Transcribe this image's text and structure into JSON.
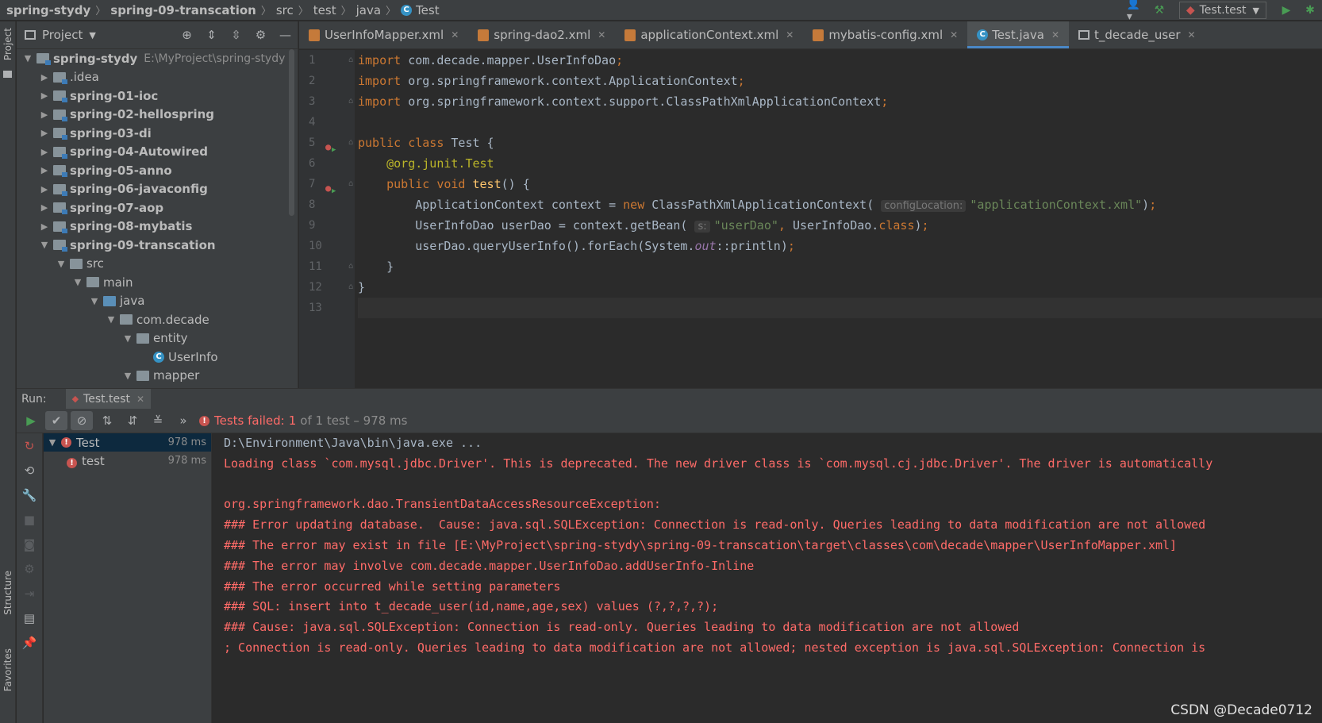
{
  "navbar": {
    "breadcrumbs": [
      "spring-stydy",
      "spring-09-transcation",
      "src",
      "test",
      "java",
      "Test"
    ],
    "run_config": "Test.test"
  },
  "left_strip": {
    "project_label": "Project",
    "structure_label": "Structure",
    "favorites_label": "Favorites"
  },
  "project": {
    "title": "Project",
    "tree": [
      {
        "label": "spring-stydy",
        "extra": "E:\\MyProject\\spring-stydy",
        "arrow": "▼",
        "bold": true,
        "indent": 0
      },
      {
        "label": ".idea",
        "arrow": "▶",
        "bold": false,
        "indent": 1
      },
      {
        "label": "spring-01-ioc",
        "arrow": "▶",
        "bold": true,
        "indent": 1
      },
      {
        "label": "spring-02-hellospring",
        "arrow": "▶",
        "bold": true,
        "indent": 1
      },
      {
        "label": "spring-03-di",
        "arrow": "▶",
        "bold": true,
        "indent": 1
      },
      {
        "label": "spring-04-Autowired",
        "arrow": "▶",
        "bold": true,
        "indent": 1
      },
      {
        "label": "spring-05-anno",
        "arrow": "▶",
        "bold": true,
        "indent": 1
      },
      {
        "label": "spring-06-javaconfig",
        "arrow": "▶",
        "bold": true,
        "indent": 1
      },
      {
        "label": "spring-07-aop",
        "arrow": "▶",
        "bold": true,
        "indent": 1
      },
      {
        "label": "spring-08-mybatis",
        "arrow": "▶",
        "bold": true,
        "indent": 1
      },
      {
        "label": "spring-09-transcation",
        "arrow": "▼",
        "bold": true,
        "indent": 1
      },
      {
        "label": "src",
        "arrow": "▼",
        "bold": false,
        "indent": 2
      },
      {
        "label": "main",
        "arrow": "▼",
        "bold": false,
        "indent": 3
      },
      {
        "label": "java",
        "arrow": "▼",
        "bold": false,
        "indent": 4
      },
      {
        "label": "com.decade",
        "arrow": "▼",
        "bold": false,
        "indent": 5
      },
      {
        "label": "entity",
        "arrow": "▼",
        "bold": false,
        "indent": 6
      },
      {
        "label": "UserInfo",
        "arrow": "",
        "bold": false,
        "indent": 7,
        "class": true
      },
      {
        "label": "mapper",
        "arrow": "▼",
        "bold": false,
        "indent": 6
      }
    ]
  },
  "tabs": [
    {
      "label": "UserInfoMapper.xml",
      "icon": "xml-file-icon",
      "active": false
    },
    {
      "label": "spring-dao2.xml",
      "icon": "xml-file-icon",
      "active": false
    },
    {
      "label": "applicationContext.xml",
      "icon": "xml-file-icon",
      "active": false
    },
    {
      "label": "mybatis-config.xml",
      "icon": "xml-file-icon",
      "active": false
    },
    {
      "label": "Test.java",
      "icon": "class-icon",
      "active": true
    },
    {
      "label": "t_decade_user",
      "icon": "table-icon",
      "active": false
    }
  ],
  "code": {
    "line_numbers": [
      "1",
      "2",
      "3",
      "4",
      "5",
      "6",
      "7",
      "8",
      "9",
      "10",
      "11",
      "12",
      "13"
    ],
    "hint_config": "configLocation:",
    "hint_s": "s:"
  },
  "run": {
    "label": "Run:",
    "tab": "Test.test",
    "status_prefix": "Tests failed:",
    "status_count": "1",
    "status_rest": "of 1 test – 978 ms",
    "tree": [
      {
        "label": "Test",
        "time": "978 ms"
      },
      {
        "label": "test",
        "time": "978 ms"
      }
    ],
    "console": [
      "D:\\Environment\\Java\\bin\\java.exe ...",
      "Loading class `com.mysql.jdbc.Driver'. This is deprecated. The new driver class is `com.mysql.cj.jdbc.Driver'. The driver is automatically",
      "",
      "org.springframework.dao.TransientDataAccessResourceException: ",
      "### Error updating database.  Cause: java.sql.SQLException: Connection is read-only. Queries leading to data modification are not allowed",
      "### The error may exist in file [E:\\MyProject\\spring-stydy\\spring-09-transcation\\target\\classes\\com\\decade\\mapper\\UserInfoMapper.xml]",
      "### The error may involve com.decade.mapper.UserInfoDao.addUserInfo-Inline",
      "### The error occurred while setting parameters",
      "### SQL: insert into t_decade_user(id,name,age,sex) values (?,?,?,?);",
      "### Cause: java.sql.SQLException: Connection is read-only. Queries leading to data modification are not allowed",
      "; Connection is read-only. Queries leading to data modification are not allowed; nested exception is java.sql.SQLException: Connection is"
    ]
  },
  "watermark": "CSDN @Decade0712",
  "colors": {
    "keyword": "#cc7832",
    "string": "#6a8759",
    "annotation": "#bbb529",
    "method": "#ffc66d",
    "error": "#ff6b68",
    "accent": "#4a88c7"
  }
}
